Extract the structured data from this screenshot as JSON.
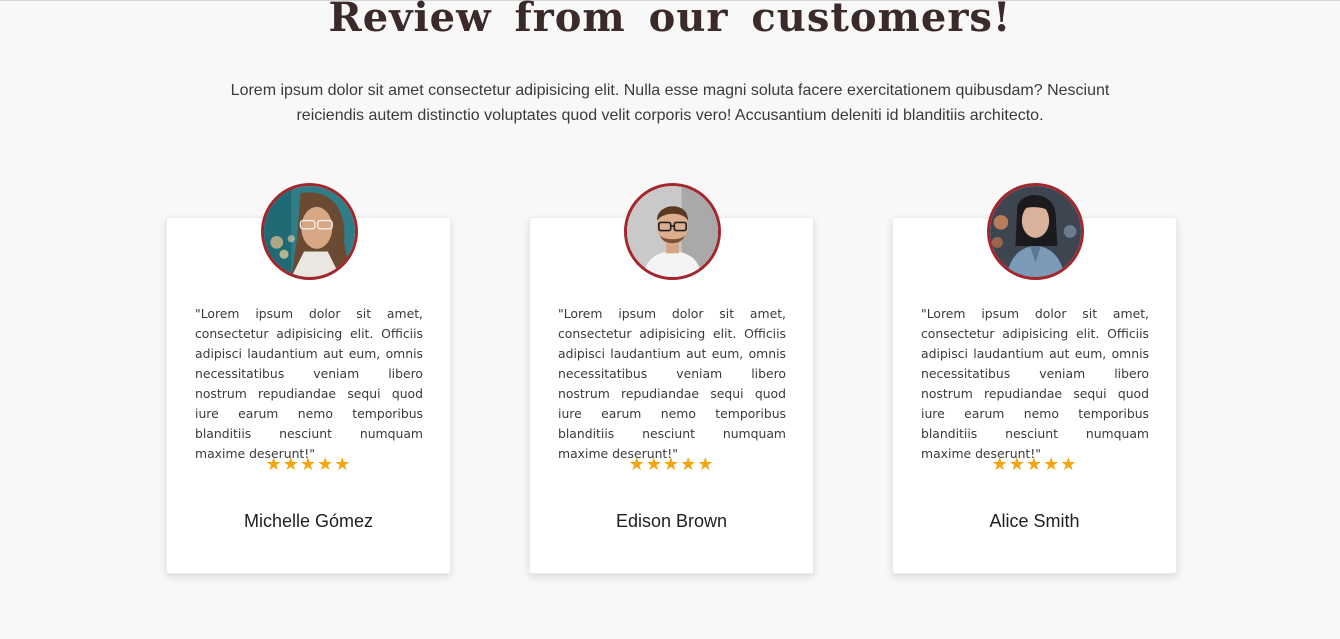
{
  "section": {
    "title": "Review from our customers!",
    "intro": "Lorem ipsum dolor sit amet consectetur adipisicing elit. Nulla esse magni soluta facere exercitationem quibusdam? Nesciunt reiciendis autem distinctio voluptates quod velit corporis vero! Accusantium deleniti id blanditiis architecto."
  },
  "colors": {
    "title": "#3b2a2a",
    "avatar_border": "#a3262c",
    "stars": "#f5a50f"
  },
  "reviews": [
    {
      "quote": "\"Lorem ipsum dolor sit amet, consectetur adipisicing elit. Officiis adipisci laudantium aut eum, omnis necessitatibus veniam libero nostrum repudiandae sequi quod iure earum nemo temporibus blanditiis nesciunt numquam maxime deserunt!\"",
      "stars": "★★★★★",
      "rating": 5,
      "name": "Michelle Gómez"
    },
    {
      "quote": "\"Lorem ipsum dolor sit amet, consectetur adipisicing elit. Officiis adipisci laudantium aut eum, omnis necessitatibus veniam libero nostrum repudiandae sequi quod iure earum nemo temporibus blanditiis nesciunt numquam maxime deserunt!\"",
      "stars": "★★★★★",
      "rating": 5,
      "name": "Edison Brown"
    },
    {
      "quote": "\"Lorem ipsum dolor sit amet, consectetur adipisicing elit. Officiis adipisci laudantium aut eum, omnis necessitatibus veniam libero nostrum repudiandae sequi quod iure earum nemo temporibus blanditiis nesciunt numquam maxime deserunt!\"",
      "stars": "★★★★★",
      "rating": 5,
      "name": "Alice Smith"
    }
  ]
}
